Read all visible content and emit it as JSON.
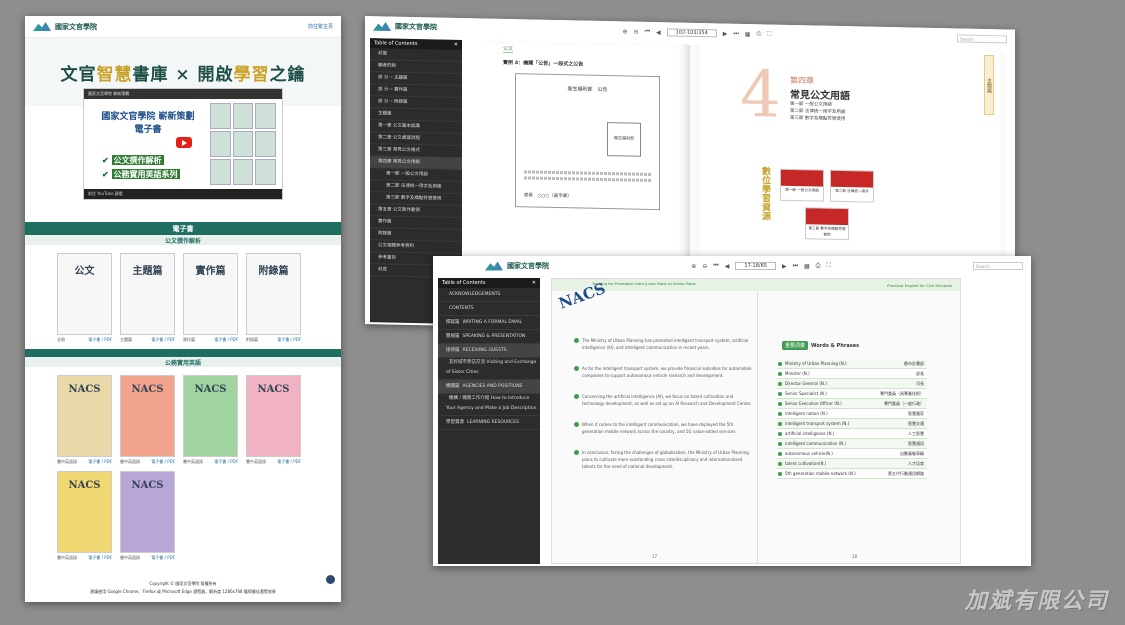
{
  "site": {
    "logo_text": "國家文官學院",
    "lang_link": "前往繁主頁",
    "hero_title_a": "文官",
    "hero_title_b": "智慧",
    "hero_title_c": "書庫 × 開啟",
    "hero_title_d": "學習",
    "hero_title_e": "之鑰",
    "video": {
      "top_text": "國家文官學院 嶄新策劃",
      "title_line1": "國家文官學院 嶄新策劃",
      "title_line2": "電子書",
      "check1": "公文撰作解析",
      "check2": "公務實用英語系列",
      "bottom_text": "前往 YouTube 觀看"
    },
    "ebook_header": "電子書",
    "section1": "公文撰作解析",
    "books1": [
      {
        "title": "公文",
        "name": "全冊",
        "link": "電子書 / PDF"
      },
      {
        "title": "主題篇",
        "name": "主題篇",
        "link": "電子書 / PDF"
      },
      {
        "title": "實作篇",
        "name": "實作篇",
        "link": "電子書 / PDF"
      },
      {
        "title": "附錄篇",
        "name": "附錄篇",
        "link": "電子書 / PDF"
      }
    ],
    "section2": "公務實用英語",
    "books2": [
      {
        "title": "NACS",
        "name": "書中英語錄",
        "link": "電子書 / PDF"
      },
      {
        "title": "NACS",
        "name": "書中英語錄",
        "link": "電子書 / PDF"
      },
      {
        "title": "NACS",
        "name": "書中英語錄",
        "link": "電子書 / PDF"
      },
      {
        "title": "NACS",
        "name": "書中英語錄",
        "link": "電子書 / PDF"
      },
      {
        "title": "NACS",
        "name": "書中英語錄",
        "link": "電子書 / PDF"
      },
      {
        "title": "NACS",
        "name": "書中英語錄",
        "link": "電子書 / PDF"
      }
    ],
    "footer_line1": "Copyright © 國家文官學院 版權所有",
    "footer_line2": "建議使用 Google Chrome、Firefox 或 Microsoft Edge 瀏覽器，解析度 1280x768 獲得最佳瀏覽效果"
  },
  "reader1": {
    "page_input": "102-103/354",
    "search_placeholder": "Search",
    "toc_title": "Table of Contents",
    "toc_items": [
      "封面",
      "編者的話",
      "部 分 ─ 主題篇",
      "部 分 ─ 實作篇",
      "部 分 ─ 附錄篇",
      "主題篇",
      "第一章 公文基本認識",
      "第二章 公文處理流程",
      "第三章 常見公文格式",
      "第四章 常見公文用語",
      "第一節 一般公文用語",
      "第二節 法律統一用字及用語",
      "第三節 數字及標點符號使用",
      "第五章 公文製作要領",
      "實作篇",
      "附錄篇",
      "公文相關參考資料",
      "參考書目",
      "封底"
    ],
    "chapter_num": "4",
    "chapter_label": "第四章",
    "chapter_title": "常見公文用語",
    "sections": [
      "第一節 一般公文用語",
      "第二節 法律統一用字及用語",
      "第三節 數字及標點符號使用"
    ],
    "side_tab": "主題篇",
    "digital": "數位學習資源",
    "videos": [
      "第一節 一般公文用語",
      "第二節 法律統一用字",
      "第三節 數字及標點符號使用"
    ],
    "left_page_header": "公文",
    "left_page_title": "實例 4：機關「公告」一段式之公告",
    "doc_agency": "衛生福利部　公告",
    "doc_seal": "衛生福利部",
    "doc_sign": "部長　○○○（簽字章）"
  },
  "reader2": {
    "page_input": "17-18/65",
    "search_placeholder": "Search",
    "toc_title": "Table of Contents",
    "toc_items": [
      {
        "k": "",
        "v": "ACKNOWLEDGEMENTS"
      },
      {
        "k": "",
        "v": "CONTENTS"
      },
      {
        "k": "撰寫篇",
        "v": "WRITING A FORMAL EMAIL"
      },
      {
        "k": "簡報篇",
        "v": "SPEAKING & PRESENTATION"
      },
      {
        "k": "接待篇",
        "v": "RECEIVING GUESTS"
      },
      {
        "k": "",
        "v": "友好城市參訪交流 Visiting and Exchange of Sister Cities"
      },
      {
        "k": "機關篇",
        "v": "AGENCIES AND POSITIONS"
      },
      {
        "k": "",
        "v": "機構 / 職務工作介紹 How to Introduce Your Agency and Make a Job Description"
      },
      {
        "k": "學習資源",
        "v": "LEARNING RESOURCES"
      }
    ],
    "header_left": "Training for Promotion from Junior Rank to Senior Rank",
    "header_right": "Practical English for Civil Servants",
    "paragraphs": [
      "The Ministry of Urban Planning has promoted intelligent transport system, artificial intelligence (AI), and intelligent communication in recent years.",
      "As for the intelligent transport system, we provide financial subsidies for automobile companies to support autonomous vehicle research and development.",
      "Concerning the artificial intelligence (AI), we focus on talent cultivation and technology development, as well as set up an AI Research and Development Center.",
      "When it comes to the intelligent communication, we have deployed the 5th generation mobile network across the country, and 5G value-added services.",
      "In conclusion, facing the challenges of globalisation, the Ministry of Urban Planning plans to cultivate more outstanding cross interdisciplinary and internationalised talents for the need of national development."
    ],
    "words_badge": "重要詞彙",
    "words_title": "Words & Phrases",
    "words": [
      {
        "en": "Ministry of Urban Planning (N.)",
        "zh": "都市計畫部"
      },
      {
        "en": "Minister (N.)",
        "zh": "部長"
      },
      {
        "en": "Director General (N.)",
        "zh": "司長"
      },
      {
        "en": "Senior Specialist (N.)",
        "zh": "專門委員（具專業技術）"
      },
      {
        "en": "Senior Executive Officer (N.)",
        "zh": "專門委員（一般行政）"
      },
      {
        "en": "intelligent nation (N.)",
        "zh": "智慧國家"
      },
      {
        "en": "intelligent transport system (N.)",
        "zh": "智慧交通"
      },
      {
        "en": "artificial intelligence (N.)",
        "zh": "人工智慧"
      },
      {
        "en": "intelligent communication (N.)",
        "zh": "智慧通訊"
      },
      {
        "en": "autonomous vehicle(N.)",
        "zh": "自動駕駛車輛"
      },
      {
        "en": "talent cultivation(N.)",
        "zh": "人才培育"
      },
      {
        "en": "5th generation mobile network (N.)",
        "zh": "第五代行動通訊網路"
      }
    ],
    "page_num_left": "17",
    "page_num_right": "18"
  },
  "watermark": "加斌有限公司"
}
